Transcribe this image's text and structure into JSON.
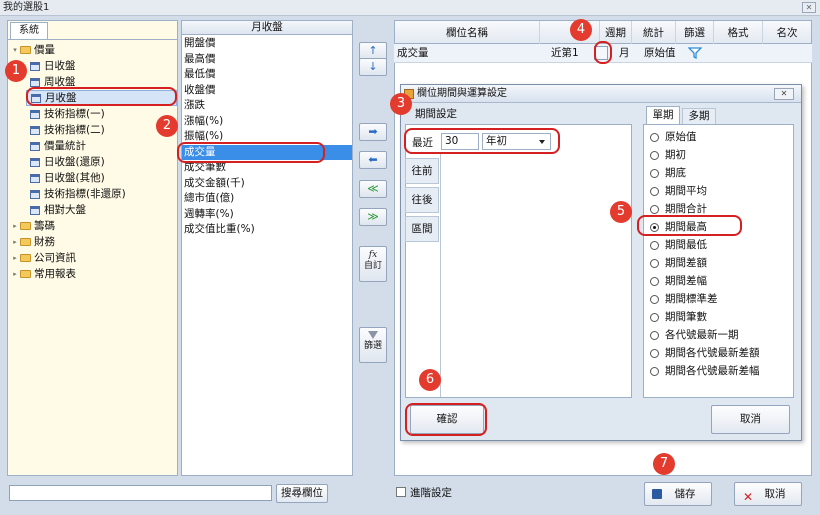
{
  "window": {
    "title": "我的選股1",
    "close": "✕"
  },
  "tree": {
    "tab": "系統",
    "items": [
      {
        "label": "價量",
        "kind": "folder",
        "open": true,
        "depth": 0
      },
      {
        "label": "日收盤",
        "kind": "table",
        "depth": 1
      },
      {
        "label": "周收盤",
        "kind": "table",
        "depth": 1
      },
      {
        "label": "月收盤",
        "kind": "table",
        "depth": 1,
        "selected": true
      },
      {
        "label": "技術指標(一)",
        "kind": "table",
        "depth": 1
      },
      {
        "label": "技術指標(二)",
        "kind": "table",
        "depth": 1
      },
      {
        "label": "價量統計",
        "kind": "table",
        "depth": 1
      },
      {
        "label": "日收盤(還原)",
        "kind": "table",
        "depth": 1
      },
      {
        "label": "日收盤(其他)",
        "kind": "table",
        "depth": 1
      },
      {
        "label": "技術指標(非還原)",
        "kind": "table",
        "depth": 1
      },
      {
        "label": "相對大盤",
        "kind": "table",
        "depth": 1
      },
      {
        "label": "籌碼",
        "kind": "folder",
        "open": false,
        "depth": 0
      },
      {
        "label": "財務",
        "kind": "folder",
        "open": false,
        "depth": 0
      },
      {
        "label": "公司資訊",
        "kind": "folder",
        "open": false,
        "depth": 0
      },
      {
        "label": "常用報表",
        "kind": "folder",
        "open": false,
        "depth": 0
      }
    ]
  },
  "fields": {
    "header": "月收盤",
    "items": [
      "開盤價",
      "最高價",
      "最低價",
      "收盤價",
      "漲跌",
      "漲幅(%)",
      "振幅(%)",
      "成交量",
      "成交筆數",
      "成交金額(千)",
      "總市值(億)",
      "週轉率(%)",
      "成交值比重(%)"
    ],
    "selected_index": 7
  },
  "mid_buttons": {
    "up": "↑",
    "down": "↓",
    "add": "➡",
    "remove": "⬅",
    "add_all": "≫",
    "remove_all": "≪",
    "custom_icon": "fx",
    "custom_label": "自訂",
    "filter_label": "篩選"
  },
  "grid": {
    "headers": [
      "欄位名稱",
      "",
      "週期",
      "統計",
      "篩選",
      "格式",
      "名次"
    ],
    "row": {
      "name": "成交量",
      "period": "近第1",
      "cycle": "月",
      "stat": "原始值"
    }
  },
  "dialog": {
    "title": "欄位期間與運算設定",
    "close": "✕",
    "period_section": "期間設定",
    "recent_label": "最近",
    "recent_value": "30",
    "unit_value": "年初",
    "vtabs": [
      "往前",
      "往後",
      "區間"
    ],
    "tabs": [
      "單期",
      "多期"
    ],
    "options": [
      "原始值",
      "期初",
      "期底",
      "期間平均",
      "期間合計",
      "期間最高",
      "期間最低",
      "期間差額",
      "期間差幅",
      "期間標準差",
      "期間筆數",
      "各代號最新一期",
      "期間各代號最新差額",
      "期間各代號最新差幅"
    ],
    "selected_option": 5,
    "confirm": "確認",
    "cancel": "取消"
  },
  "bottom": {
    "search_placeholder": "",
    "search_button": "搜尋欄位",
    "advanced": "進階設定",
    "save": "儲存",
    "cancel": "取消"
  },
  "callouts": [
    "1",
    "2",
    "3",
    "4",
    "5",
    "6",
    "7"
  ],
  "colors": {
    "accent": "#3b8ee8",
    "callout": "#e33b2e",
    "highlight": "#d42020"
  }
}
